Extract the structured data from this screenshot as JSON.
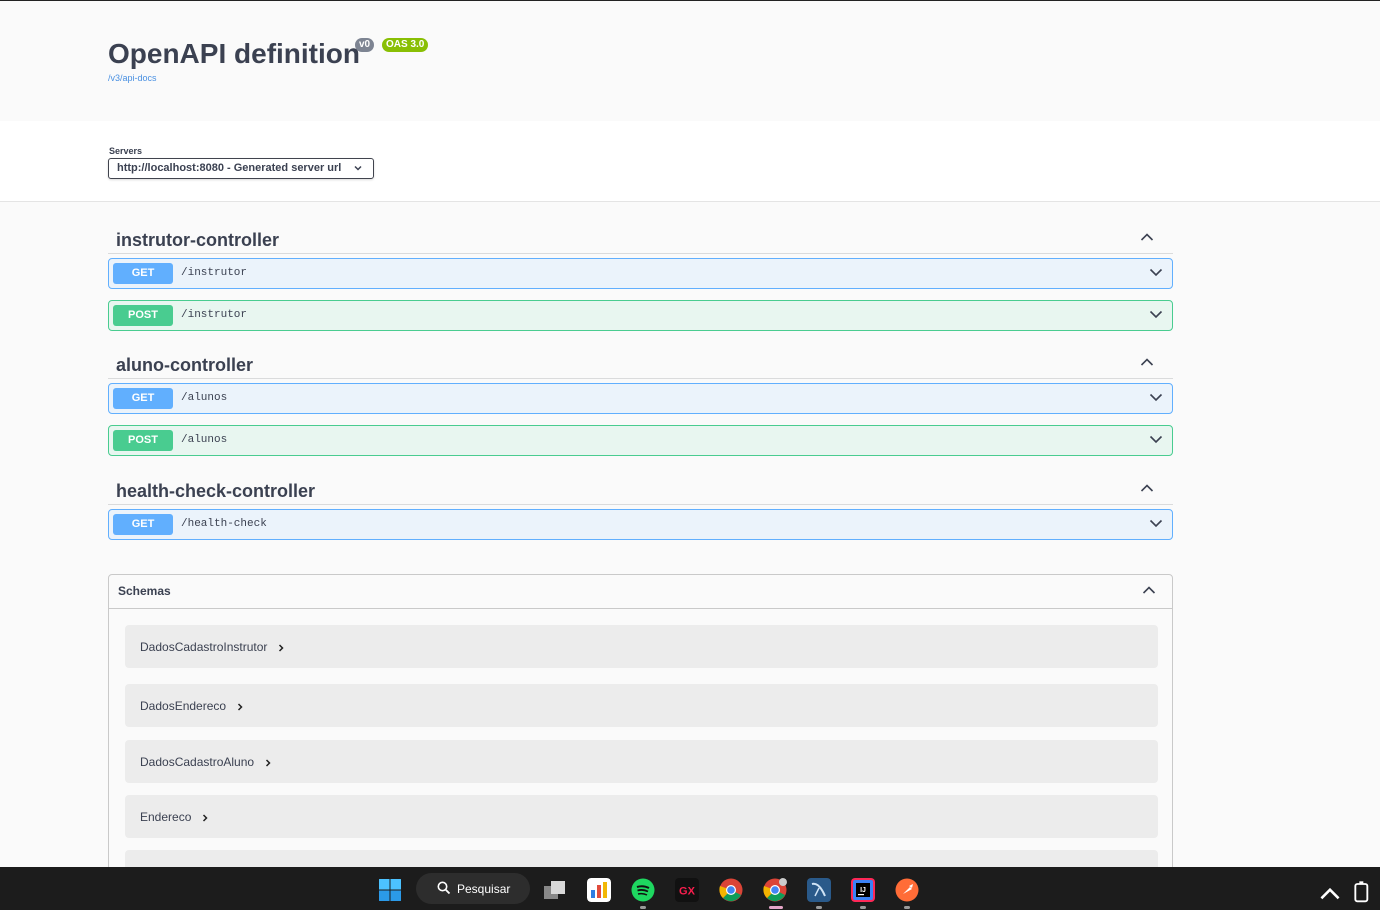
{
  "header": {
    "title": "OpenAPI definition",
    "version_badge": "v0",
    "oas_badge": "OAS 3.0",
    "docs_link": "/v3/api-docs"
  },
  "servers": {
    "label": "Servers",
    "selected": "http://localhost:8080 - Generated server url"
  },
  "tags": [
    {
      "name": "instrutor-controller",
      "operations": [
        {
          "method": "GET",
          "path": "/instrutor"
        },
        {
          "method": "POST",
          "path": "/instrutor"
        }
      ]
    },
    {
      "name": "aluno-controller",
      "operations": [
        {
          "method": "GET",
          "path": "/alunos"
        },
        {
          "method": "POST",
          "path": "/alunos"
        }
      ]
    },
    {
      "name": "health-check-controller",
      "operations": [
        {
          "method": "GET",
          "path": "/health-check"
        }
      ]
    }
  ],
  "schemas": {
    "title": "Schemas",
    "models": [
      "DadosCadastroInstrutor",
      "DadosEndereco",
      "DadosCadastroAluno",
      "Endereco"
    ]
  },
  "taskbar": {
    "search_label": "Pesquisar",
    "apps": [
      "windows-start-icon",
      "task-view-icon",
      "charts-app-icon",
      "spotify-icon",
      "opera-gx-icon",
      "chrome-icon",
      "chrome-profile-icon",
      "mysql-workbench-icon",
      "intellij-icon",
      "postman-icon"
    ]
  }
}
